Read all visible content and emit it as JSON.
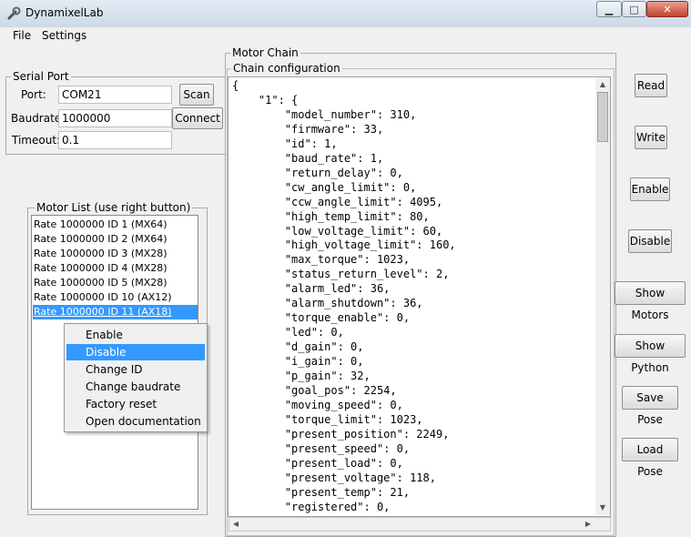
{
  "window": {
    "title": "DynamixelLab",
    "min_glyph": "▁",
    "max_glyph": "□",
    "close_glyph": "✕",
    "app_icon": "wrench-icon"
  },
  "menu": {
    "file": "File",
    "settings": "Settings"
  },
  "serial": {
    "legend": "Serial Port",
    "port_label": "Port:",
    "port_value": "COM21",
    "baud_label": "Baudrate:",
    "baud_value": "1000000",
    "timeout_label": "Timeout:",
    "timeout_value": "0.1",
    "scan": "Scan",
    "connect": "Connect"
  },
  "motor_list": {
    "legend": "Motor List (use right button)",
    "items": [
      "Rate 1000000 ID 1 (MX64)",
      "Rate 1000000 ID 2 (MX64)",
      "Rate 1000000 ID 3 (MX28)",
      "Rate 1000000 ID 4 (MX28)",
      "Rate 1000000 ID 5 (MX28)",
      "Rate 1000000 ID 10 (AX12)",
      "Rate 1000000 ID 11 (AX18)"
    ],
    "selected_index": 6
  },
  "context_menu": {
    "items": [
      "Enable",
      "Disable",
      "Change ID",
      "Change baudrate",
      "Factory reset",
      "Open documentation"
    ],
    "highlighted_index": 1
  },
  "chain": {
    "legend": "Motor Chain",
    "config_legend": "Chain configuration",
    "text": "{\n    \"1\": {\n        \"model_number\": 310,\n        \"firmware\": 33,\n        \"id\": 1,\n        \"baud_rate\": 1,\n        \"return_delay\": 0,\n        \"cw_angle_limit\": 0,\n        \"ccw_angle_limit\": 4095,\n        \"high_temp_limit\": 80,\n        \"low_voltage_limit\": 60,\n        \"high_voltage_limit\": 160,\n        \"max_torque\": 1023,\n        \"status_return_level\": 2,\n        \"alarm_led\": 36,\n        \"alarm_shutdown\": 36,\n        \"torque_enable\": 0,\n        \"led\": 0,\n        \"d_gain\": 0,\n        \"i_gain\": 0,\n        \"p_gain\": 32,\n        \"goal_pos\": 2254,\n        \"moving_speed\": 0,\n        \"torque_limit\": 1023,\n        \"present_position\": 2249,\n        \"present_speed\": 0,\n        \"present_load\": 0,\n        \"present_voltage\": 118,\n        \"present_temp\": 21,\n        \"registered\": 0,"
  },
  "actions": {
    "read": "Read",
    "write": "Write",
    "enable": "Enable",
    "disable": "Disable",
    "show_motors": "Show Motors",
    "show_python": "Show Python",
    "save_pose": "Save Pose",
    "load_pose": "Load Pose"
  },
  "scroll": {
    "up": "▲",
    "down": "▼",
    "left": "◀",
    "right": "▶"
  }
}
